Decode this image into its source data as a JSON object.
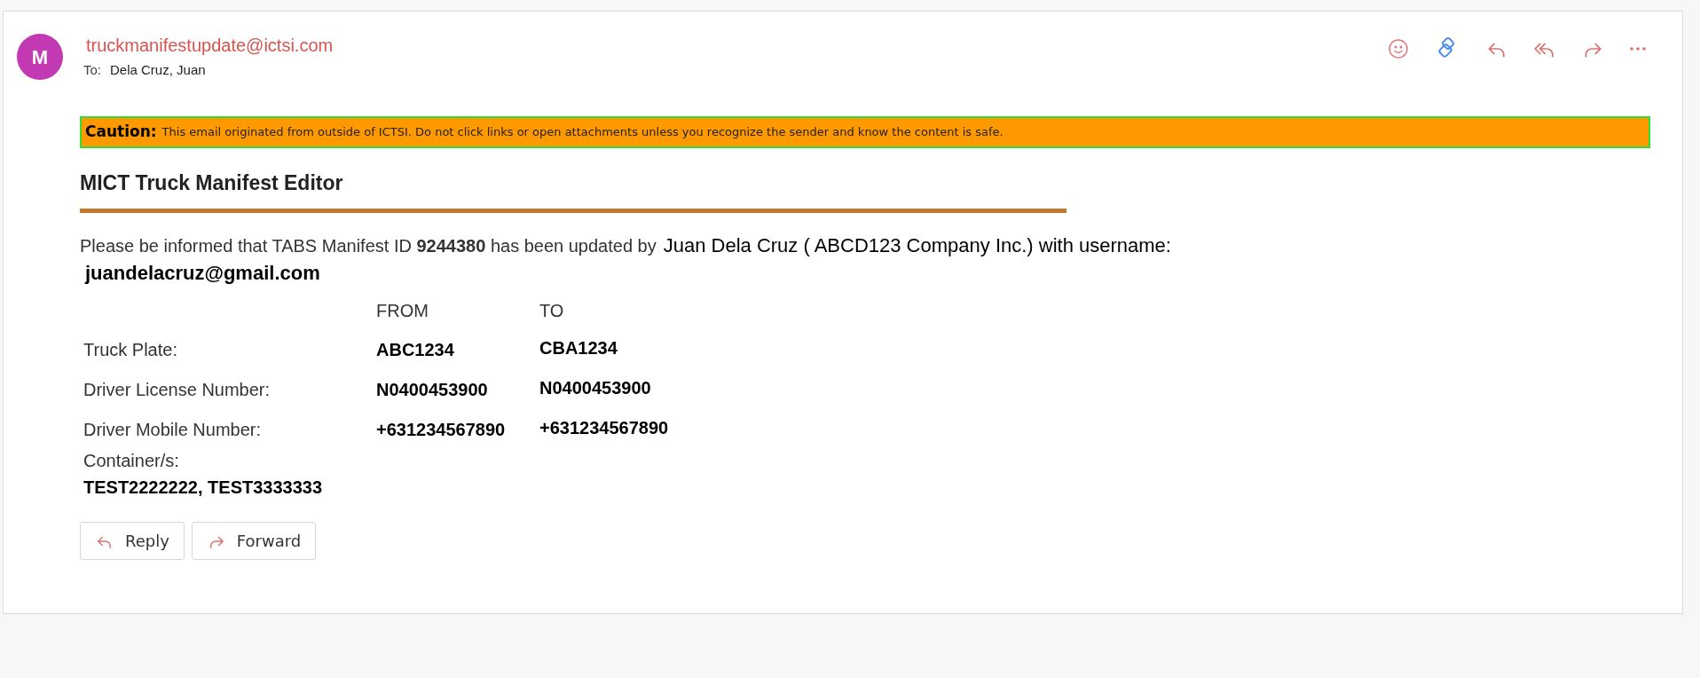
{
  "message": {
    "avatar_letter": "M",
    "sender": "truckmanifestupdate@ictsi.com",
    "to_label": "To:",
    "to": "Dela Cruz, Juan"
  },
  "caution": {
    "label": "Caution:",
    "text": "This email originated from outside of ICTSI. Do not click links or open attachments unless you recognize the sender and know the content is safe."
  },
  "body": {
    "title": "MICT Truck Manifest Editor",
    "intro": "Please be informed that TABS Manifest ID **9244380** has been updated by",
    "updater": "Juan Dela Cruz ( ABCD123 Company Inc.) with username:",
    "username": "juandelacruz@gmail.com",
    "table": {
      "columns": [
        "FROM",
        "TO"
      ],
      "rows": [
        {
          "label": "Truck Plate:",
          "from": "ABC1234",
          "to": "CBA1234"
        },
        {
          "label": "Driver License Number:",
          "from": "N0400453900",
          "to": "N0400453900"
        },
        {
          "label": "Driver Mobile Number:",
          "from": "+631234567890",
          "to": "+631234567890"
        }
      ]
    },
    "containers_label": "Container/s:",
    "containers": "TEST2222222, TEST3333333"
  },
  "buttons": [
    {
      "kind": "reply",
      "label": "Reply"
    },
    {
      "kind": "forward",
      "label": "Forward"
    }
  ]
}
